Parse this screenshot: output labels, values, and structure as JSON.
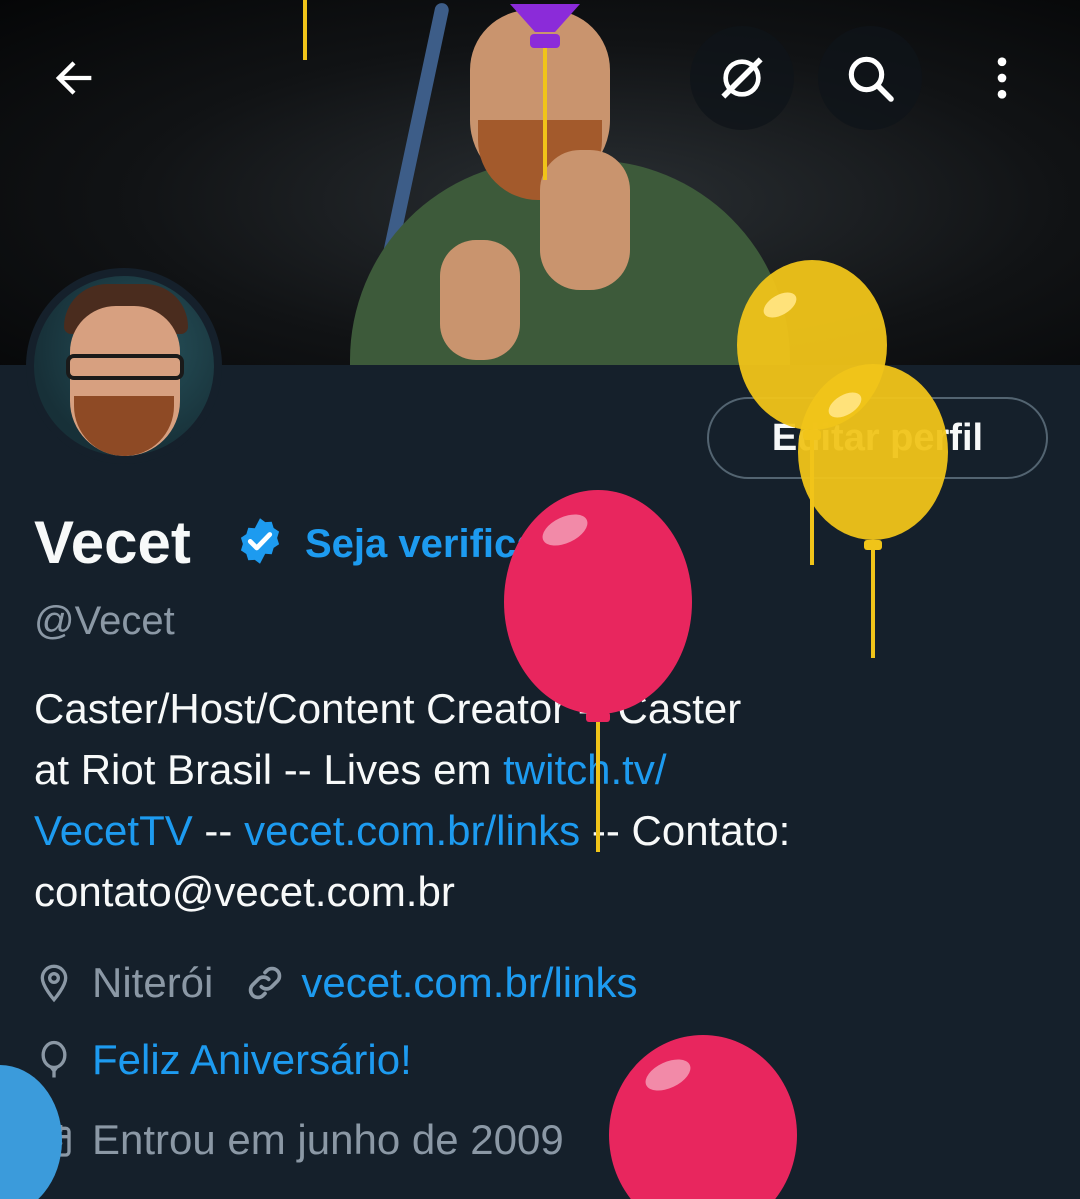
{
  "header": {
    "back_icon": "arrow-left-icon",
    "grok_icon": "grok-icon",
    "search_icon": "search-icon",
    "more_icon": "more-vertical-icon"
  },
  "profile": {
    "edit_button": "Editar perfil",
    "name": "Vecet",
    "verified_badge": "verified-badge-icon",
    "get_verified": "Seja verificado",
    "handle": "@Vecet",
    "bio": {
      "line1": "Caster/Host/Content Creator -- Caster",
      "line2_text": "at Riot Brasil -- Lives em ",
      "line2_link": "twitch.tv/",
      "line3_link1": "VecetTV",
      "line3_sep": " -- ",
      "line3_link2": "vecet.com.br/links",
      "line3_text": " -- Contato:",
      "line4": "contato@vecet.com.br"
    },
    "location": "Niterói",
    "website": "vecet.com.br/links",
    "birthday": "Feliz Aniversário!",
    "joined": "Entrou em junho de 2009"
  },
  "colors": {
    "background": "#15202b",
    "accent": "#1d9bf0",
    "muted": "#8b98a5",
    "balloon_yellow": "#f0c419",
    "balloon_red": "#e8265e",
    "balloon_blue": "#3b9bdb"
  }
}
